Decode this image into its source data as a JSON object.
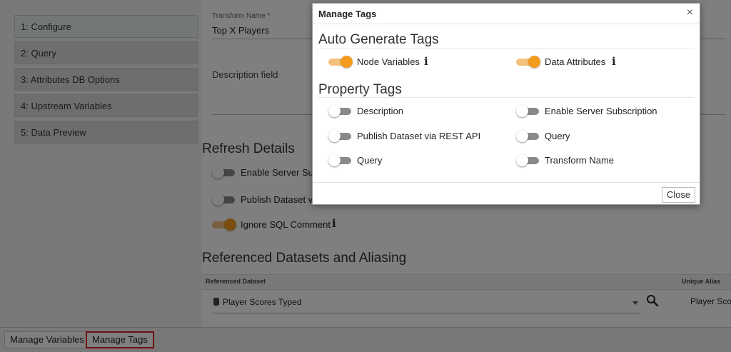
{
  "nav": {
    "items": [
      {
        "label": "1: Configure"
      },
      {
        "label": "2: Query"
      },
      {
        "label": "3: Attributes DB Options"
      },
      {
        "label": "4: Upstream Variables"
      },
      {
        "label": "5: Data Preview"
      }
    ]
  },
  "form": {
    "transform_name_label": "Transform Name *",
    "transform_name_value": "Top X Players",
    "description_label": "Description field"
  },
  "refresh": {
    "title": "Refresh Details",
    "items": [
      {
        "label": "Enable Server Sub",
        "on": false
      },
      {
        "label": "Publish Dataset v",
        "on": false
      },
      {
        "label": "Ignore SQL Comment",
        "on": true
      }
    ]
  },
  "datasets": {
    "title": "Referenced Datasets and Aliasing",
    "col_dataset": "Referenced Dataset",
    "col_alias": "Unique Alias",
    "row_dataset": "Player Scores Typed",
    "row_alias": "Player Scor"
  },
  "footer": {
    "manage_variables": "Manage Variables",
    "manage_tags": "Manage Tags"
  },
  "modal": {
    "title": "Manage Tags",
    "close_symbol": "×",
    "auto_title": "Auto Generate Tags",
    "auto_items": [
      {
        "label": "Node Variables",
        "on": true,
        "info": true
      },
      {
        "label": "Data Attributes",
        "on": true,
        "info": true
      }
    ],
    "property_title": "Property Tags",
    "property_items": [
      {
        "label": "Description",
        "on": false
      },
      {
        "label": "Enable Server Subscription",
        "on": false
      },
      {
        "label": "Publish Dataset via REST API",
        "on": false
      },
      {
        "label": "Query",
        "on": false
      },
      {
        "label": "Query",
        "on": false
      },
      {
        "label": "Transform Name",
        "on": false
      }
    ],
    "close_button": "Close"
  },
  "colors": {
    "toggle_on": "#f39c1e",
    "highlight_border": "#dd2222"
  }
}
